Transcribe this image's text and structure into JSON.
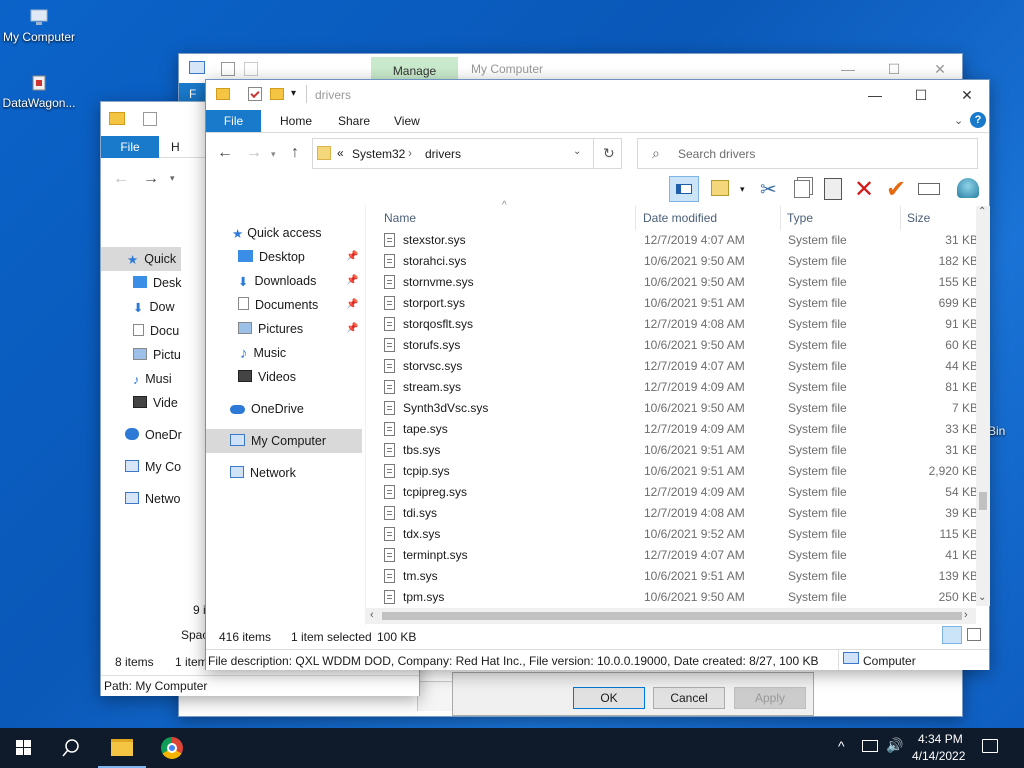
{
  "desktop": {
    "icons": [
      {
        "label": "My Computer"
      },
      {
        "label": "DataWagon..."
      }
    ],
    "bin_partial": "Bin"
  },
  "back_window": {
    "manage_tab": "Manage",
    "title": "My Computer",
    "file_tab": "F"
  },
  "left_window": {
    "file_tab": "File",
    "home_tab_partial": "H",
    "nav": [
      {
        "label": "Quick",
        "icon": "star-icon"
      },
      {
        "label": "Desk",
        "icon": "desktop-icon"
      },
      {
        "label": "Dow",
        "icon": "download-icon"
      },
      {
        "label": "Docu",
        "icon": "document-icon"
      },
      {
        "label": "Pictu",
        "icon": "pictures-icon"
      },
      {
        "label": "Musi",
        "icon": "music-icon"
      },
      {
        "label": "Vide",
        "icon": "video-icon"
      },
      {
        "label": "OneDr",
        "icon": "cloud-icon"
      },
      {
        "label": "My Co",
        "icon": "computer-icon"
      },
      {
        "label": "Netwo",
        "icon": "network-icon"
      }
    ],
    "status_items": "8 items",
    "status_partial": "1 item",
    "path": "Path: My Computer",
    "items_partial": "9 i",
    "space_partial": "Spac"
  },
  "main_window": {
    "title": "drivers",
    "tabs": {
      "file": "File",
      "home": "Home",
      "share": "Share",
      "view": "View"
    },
    "breadcrumb": {
      "chevron": "«",
      "parts": [
        "System32",
        "drivers"
      ]
    },
    "search_placeholder": "Search drivers",
    "nav": [
      {
        "label": "Quick access",
        "icon": "star-icon",
        "pinned": false
      },
      {
        "label": "Desktop",
        "icon": "desktop-icon",
        "pinned": true
      },
      {
        "label": "Downloads",
        "icon": "download-icon",
        "pinned": true
      },
      {
        "label": "Documents",
        "icon": "document-icon",
        "pinned": true
      },
      {
        "label": "Pictures",
        "icon": "pictures-icon",
        "pinned": true
      },
      {
        "label": "Music",
        "icon": "music-icon",
        "pinned": false
      },
      {
        "label": "Videos",
        "icon": "video-icon",
        "pinned": false
      },
      {
        "label": "OneDrive",
        "icon": "cloud-icon",
        "pinned": false
      },
      {
        "label": "My Computer",
        "icon": "computer-icon",
        "pinned": false,
        "selected": true
      },
      {
        "label": "Network",
        "icon": "network-icon",
        "pinned": false
      }
    ],
    "columns": {
      "name": "Name",
      "date": "Date modified",
      "type": "Type",
      "size": "Size"
    },
    "files": [
      {
        "name": "stexstor.sys",
        "date": "12/7/2019 4:07 AM",
        "type": "System file",
        "size": "31 KB"
      },
      {
        "name": "storahci.sys",
        "date": "10/6/2021 9:50 AM",
        "type": "System file",
        "size": "182 KB"
      },
      {
        "name": "stornvme.sys",
        "date": "10/6/2021 9:50 AM",
        "type": "System file",
        "size": "155 KB"
      },
      {
        "name": "storport.sys",
        "date": "10/6/2021 9:51 AM",
        "type": "System file",
        "size": "699 KB"
      },
      {
        "name": "storqosflt.sys",
        "date": "12/7/2019 4:08 AM",
        "type": "System file",
        "size": "91 KB"
      },
      {
        "name": "storufs.sys",
        "date": "10/6/2021 9:50 AM",
        "type": "System file",
        "size": "60 KB"
      },
      {
        "name": "storvsc.sys",
        "date": "12/7/2019 4:07 AM",
        "type": "System file",
        "size": "44 KB"
      },
      {
        "name": "stream.sys",
        "date": "12/7/2019 4:09 AM",
        "type": "System file",
        "size": "81 KB"
      },
      {
        "name": "Synth3dVsc.sys",
        "date": "10/6/2021 9:50 AM",
        "type": "System file",
        "size": "7 KB"
      },
      {
        "name": "tape.sys",
        "date": "12/7/2019 4:09 AM",
        "type": "System file",
        "size": "33 KB"
      },
      {
        "name": "tbs.sys",
        "date": "10/6/2021 9:51 AM",
        "type": "System file",
        "size": "31 KB"
      },
      {
        "name": "tcpip.sys",
        "date": "10/6/2021 9:51 AM",
        "type": "System file",
        "size": "2,920 KB"
      },
      {
        "name": "tcpipreg.sys",
        "date": "12/7/2019 4:09 AM",
        "type": "System file",
        "size": "54 KB"
      },
      {
        "name": "tdi.sys",
        "date": "12/7/2019 4:08 AM",
        "type": "System file",
        "size": "39 KB"
      },
      {
        "name": "tdx.sys",
        "date": "10/6/2021 9:52 AM",
        "type": "System file",
        "size": "115 KB"
      },
      {
        "name": "terminpt.sys",
        "date": "12/7/2019 4:07 AM",
        "type": "System file",
        "size": "41 KB"
      },
      {
        "name": "tm.sys",
        "date": "10/6/2021 9:51 AM",
        "type": "System file",
        "size": "139 KB"
      },
      {
        "name": "tpm.sys",
        "date": "10/6/2021 9:50 AM",
        "type": "System file",
        "size": "250 KB"
      }
    ],
    "status": {
      "count": "416 items",
      "selected": "1 item selected",
      "size": "100 KB"
    },
    "details_bar": {
      "text": "File description: QXL WDDM DOD, Company: Red Hat Inc., File version: 10.0.0.19000, Date created: 8/27, 100 KB",
      "location": "Computer"
    }
  },
  "dialog": {
    "ok": "OK",
    "cancel": "Cancel",
    "apply": "Apply"
  },
  "taskbar": {
    "time": "4:34 PM",
    "date": "4/14/2022"
  },
  "colors": {
    "accent": "#1979ca",
    "selection": "#cce8ff",
    "nav_selected": "#d9d9d9",
    "link_blue": "#0066cc"
  }
}
